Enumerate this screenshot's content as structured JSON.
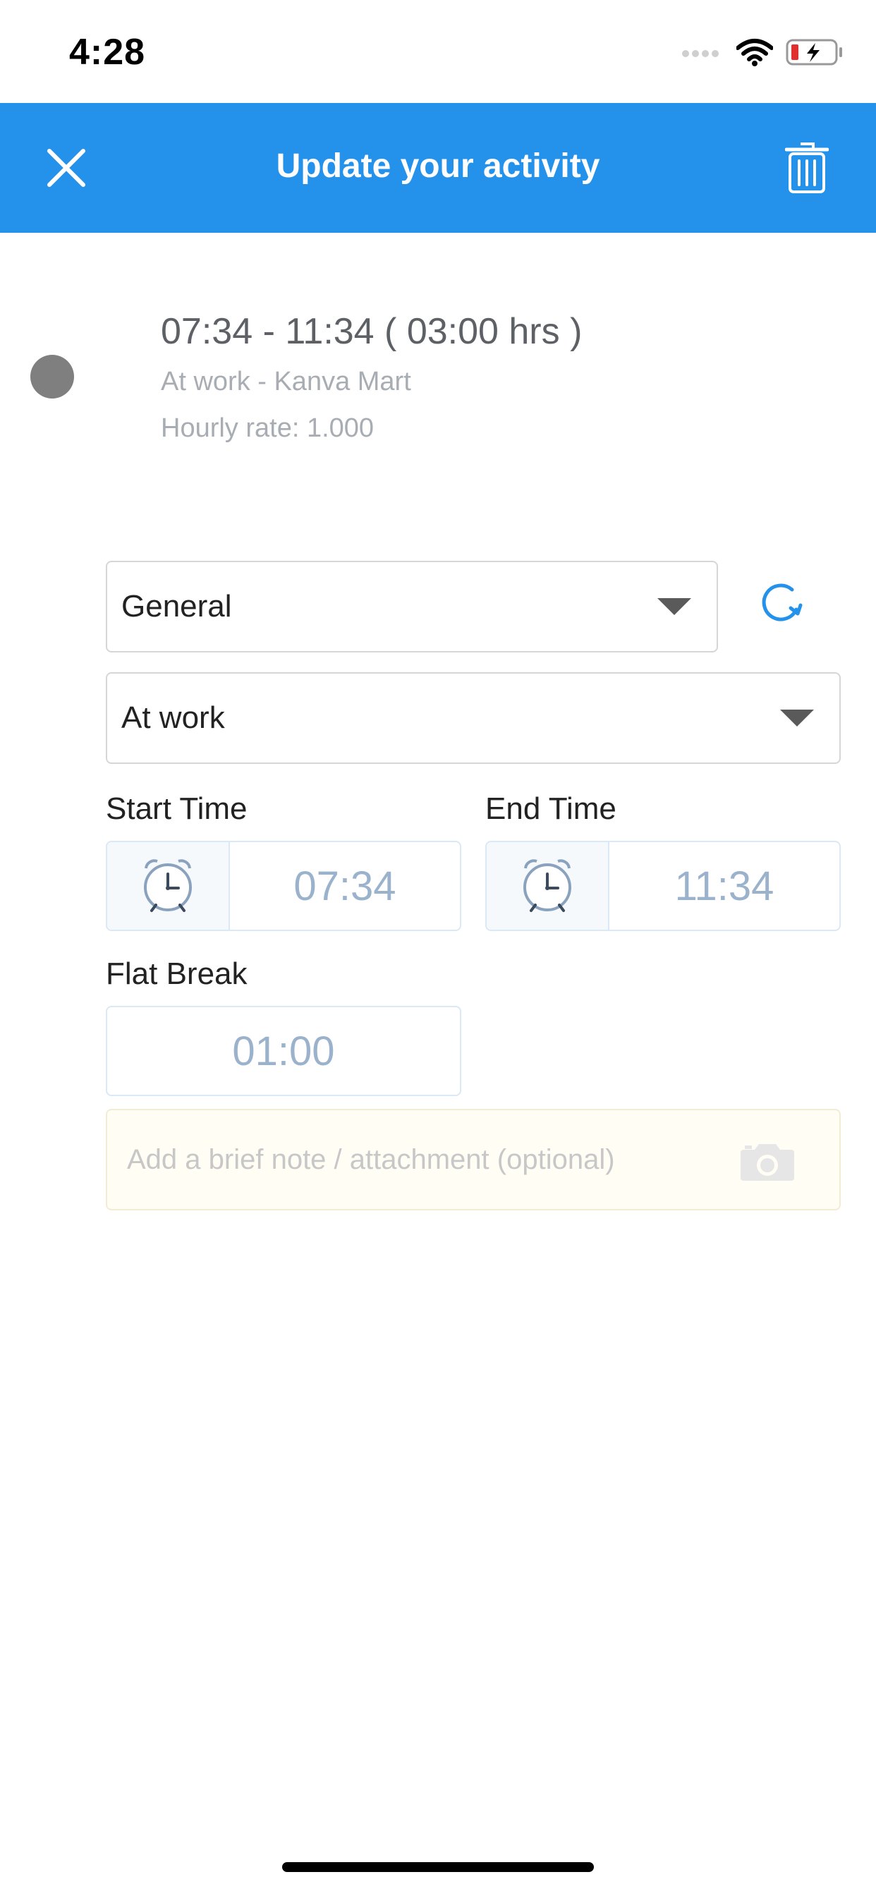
{
  "status_bar": {
    "time": "4:28"
  },
  "header": {
    "title": "Update your activity"
  },
  "summary": {
    "range": "07:34 - 11:34 ( 03:00 hrs )",
    "location": "At work - Kanva Mart",
    "rate": "Hourly rate: 1.000"
  },
  "form": {
    "category": "General",
    "status": "At work",
    "start_label": "Start Time",
    "start_value": "07:34",
    "end_label": "End Time",
    "end_value": "11:34",
    "flat_break_label": "Flat Break",
    "flat_break_value": "01:00",
    "note_placeholder": "Add a brief note / attachment (optional)"
  },
  "colors": {
    "header": "#2491EB",
    "accent": "#2491EB"
  },
  "icons": {
    "close": "close-icon",
    "trash": "trash-icon",
    "refresh": "refresh-icon",
    "alarm": "alarm-clock-icon",
    "camera": "camera-icon"
  }
}
